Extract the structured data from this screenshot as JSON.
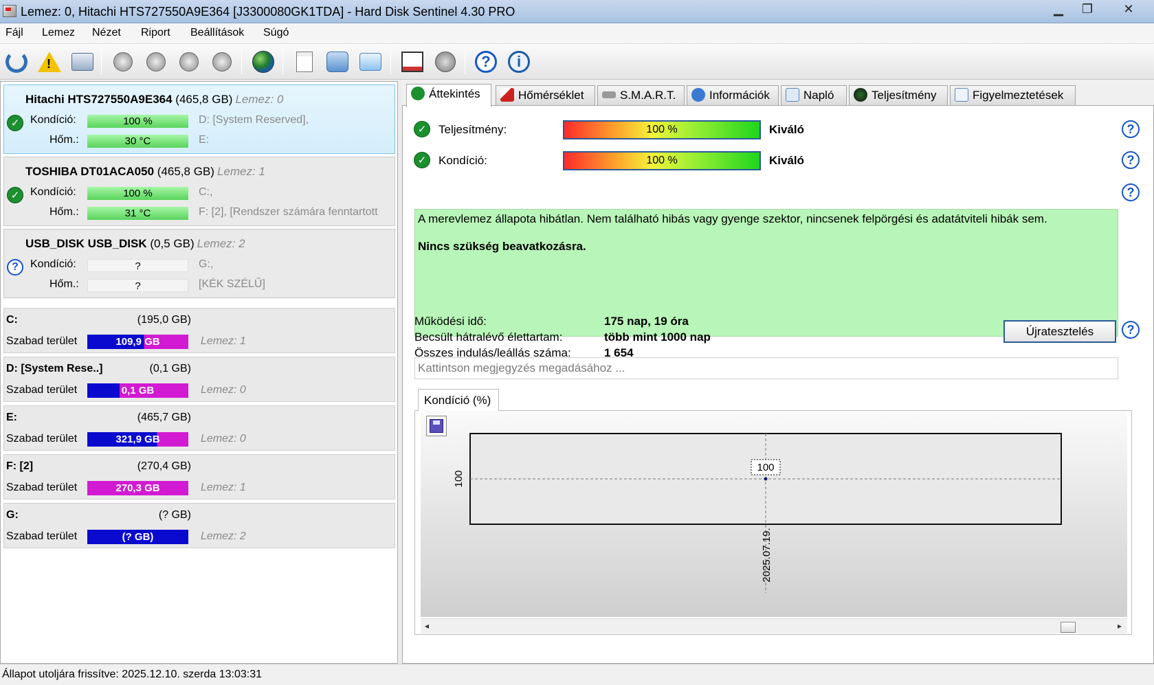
{
  "window": {
    "title": "Lemez: 0, Hitachi HTS727550A9E364 [J3300080GK1TDA]  -  Hard Disk Sentinel 4.30 PRO"
  },
  "menu": [
    "Fájl",
    "Lemez",
    "Nézet",
    "Riport",
    "Beállítások",
    "Súgó"
  ],
  "toolbar": [
    {
      "name": "refresh-icon"
    },
    {
      "name": "warning-icon"
    },
    {
      "name": "disk-icon"
    },
    {
      "name": "disk-sensor-1-icon"
    },
    {
      "name": "disk-sensor-2-icon"
    },
    {
      "name": "disk-sensor-3-icon"
    },
    {
      "name": "disk-sensor-4-icon"
    },
    {
      "name": "globe-icon"
    },
    {
      "name": "report-icon"
    },
    {
      "name": "sync-icon"
    },
    {
      "name": "network-icon"
    },
    {
      "name": "chart-icon"
    },
    {
      "name": "speaker-icon"
    },
    {
      "name": "help-icon"
    },
    {
      "name": "info-icon"
    }
  ],
  "disks": [
    {
      "name": "Hitachi HTS727550A9E364",
      "size": "(465,8 GB)",
      "index": "Lemez: 0",
      "status": "ok",
      "cond_label": "Kondíció:",
      "cond_value": "100 %",
      "temp_label": "Hőm.:",
      "temp_value": "30 °C",
      "info1": "D: [System Reserved],",
      "info2": "E:"
    },
    {
      "name": "TOSHIBA DT01ACA050",
      "size": "(465,8 GB)",
      "index": "Lemez: 1",
      "status": "ok",
      "cond_label": "Kondíció:",
      "cond_value": "100 %",
      "temp_label": "Hőm.:",
      "temp_value": "31 °C",
      "info1": "C:,",
      "info2": "F: [2],  [Rendszer számára fenntartott"
    },
    {
      "name": "USB_DISK USB_DISK",
      "size": "(0,5 GB)",
      "index": "Lemez: 2",
      "status": "unknown",
      "cond_label": "Kondíció:",
      "cond_value": "?",
      "temp_label": "Hőm.:",
      "temp_value": "?",
      "info1": "G:,",
      "info2": "[KÉK SZÉLŰ]"
    }
  ],
  "volumes": [
    {
      "name": "C:",
      "size": "(195,0 GB)",
      "free_label": "Szabad terület",
      "free": "109,9 GB",
      "disk": "Lemez: 1",
      "free_fraction": 0.56
    },
    {
      "name": "D: [System Rese..]",
      "size": "(0,1 GB)",
      "free_label": "Szabad terület",
      "free": "0,1 GB",
      "disk": "Lemez: 0",
      "free_fraction": 0.32
    },
    {
      "name": "E:",
      "size": "(465,7 GB)",
      "free_label": "Szabad terület",
      "free": "321,9 GB",
      "disk": "Lemez: 0",
      "free_fraction": 0.69
    },
    {
      "name": "F: [2]",
      "size": "(270,4 GB)",
      "free_label": "Szabad terület",
      "free": "270,3 GB",
      "disk": "Lemez: 1",
      "free_fraction": 0.0
    },
    {
      "name": "G:",
      "size": "(? GB)",
      "free_label": "Szabad terület",
      "free": "(? GB)",
      "disk": "Lemez: 2",
      "free_fraction": 1.0
    }
  ],
  "colors": {
    "used": "#d21ad2",
    "free": "#0a0acf",
    "ok_green": "#1c8f2e",
    "status_bg": "#b8f5b8"
  },
  "tabs": [
    {
      "label": "Áttekintés",
      "icon": "check-icon",
      "active": true
    },
    {
      "label": "Hőmérséklet",
      "icon": "thermometer-icon"
    },
    {
      "label": "S.M.A.R.T.",
      "icon": "smart-icon"
    },
    {
      "label": "Információk",
      "icon": "info-icon"
    },
    {
      "label": "Napló",
      "icon": "log-icon"
    },
    {
      "label": "Teljesítmény",
      "icon": "performance-icon"
    },
    {
      "label": "Figyelmeztetések",
      "icon": "alerts-icon"
    }
  ],
  "overview": {
    "performance_label": "Teljesítmény:",
    "performance_value": "100 %",
    "performance_grade": "Kiváló",
    "condition_label": "Kondíció:",
    "condition_value": "100 %",
    "condition_grade": "Kiváló",
    "message_line1": "A merevlemez állapota hibátlan. Nem található hibás vagy gyenge szektor, nincsenek felpörgési és adatátviteli hibák sem.",
    "message_line2": "Nincs szükség beavatkozásra.",
    "uptime_label": "Működési idő:",
    "uptime_value": "175 nap, 19 óra",
    "lifetime_label": "Becsült hátralévő élettartam:",
    "lifetime_value": "több mint 1000 nap",
    "starts_label": "Összes indulás/leállás száma:",
    "starts_value": "1 654",
    "retest_label": "Újratesztelés",
    "note_placeholder": "Kattintson megjegyzés megadásához ...",
    "chart_tab": "Kondíció  (%)"
  },
  "chart_data": {
    "type": "line",
    "x": [
      "2025.07.19."
    ],
    "series": [
      {
        "values": [
          100
        ]
      }
    ],
    "data_labels": [
      "100"
    ],
    "ytick_labels": [
      "100"
    ],
    "xtick_labels": [
      "2025.07.19."
    ],
    "grid": true
  },
  "statusbar": {
    "text": "Állapot utoljára frissítve: 2025.12.10. szerda 13:03:31"
  }
}
